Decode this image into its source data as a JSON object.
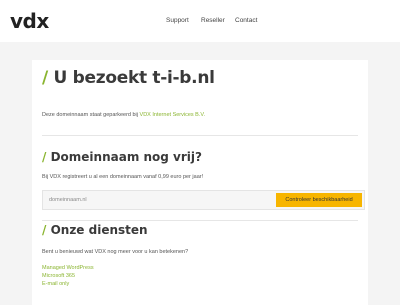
{
  "header": {
    "logo": "vdx",
    "nav": [
      "Support",
      "Reseller",
      "Contact"
    ]
  },
  "main": {
    "title_slash": "/",
    "title": "U bezoekt t-i-b.nl",
    "parked_text": "Deze domeinnaam staat geparkeerd bij",
    "parked_link": "VDX Internet Services B.V.",
    "section1_title": "Domeinnaam nog vrij?",
    "section1_text": "Bij VDX registreert u al een domeinnaam vanaf 0,99 euro per jaar!",
    "search_placeholder": "domeinnaam.nl",
    "search_button": "Controleer beschikbaarheid",
    "section2_title": "Onze diensten",
    "section2_text": "Bent u benieuwd wat VDX nog meer voor u kan betekenen?",
    "services": [
      "Managed WordPress",
      "Microsoft 365",
      "E-mail only"
    ]
  },
  "colors": {
    "accent_green": "#8ab530",
    "button_yellow": "#f7b500",
    "background": "#f4f4f4"
  }
}
